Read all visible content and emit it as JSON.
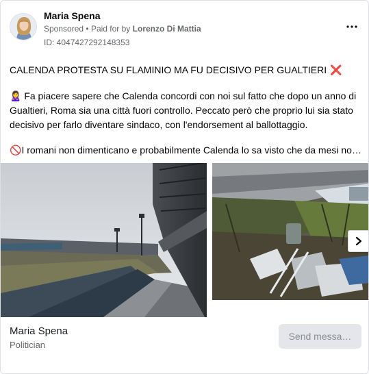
{
  "ad": {
    "author": "Maria Spena",
    "sponsored": "Sponsored",
    "separator": "•",
    "paid_for_prefix": "Paid for by",
    "payer": "Lorenzo Di Mattia",
    "ad_id": "ID: 4047427292148353",
    "more_icon": "more-options-icon"
  },
  "post": {
    "title": "CALENDA PROTESTA SU FLAMINIO MA FU DECISIVO PER GUALTIERI",
    "title_emoji": "❌",
    "paragraph_1_emoji": "🙎‍♀️",
    "paragraph_1": "Fa piacere sapere che Calenda concordi con noi sul fatto che dopo un anno di Gualtieri, Roma sia una città fuori controllo. Peccato però che proprio lui sia stato decisivo per farlo diventare sindaco, con l'endorsement al ballottaggio.",
    "paragraph_2_emoji": "🚫",
    "paragraph_2": "I romani non dimenticano e probabilmente Calenda lo sa visto che da mesi no…"
  },
  "carousel": {
    "next_icon": "chevron-right-icon"
  },
  "footer": {
    "page_name": "Maria Spena",
    "page_category": "Politician",
    "send_button": "Send messa…"
  },
  "colors": {
    "secondary_text": "#65676b",
    "button_bg": "#e4e6eb",
    "button_text": "#8a8d91",
    "border": "#dddfe2"
  }
}
